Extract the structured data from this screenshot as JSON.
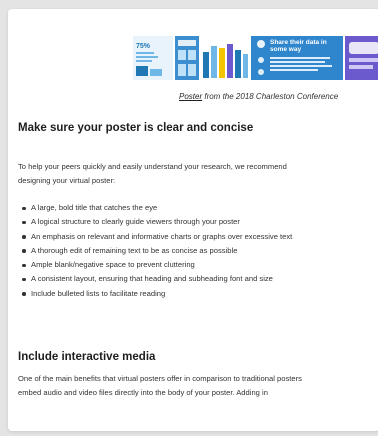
{
  "caption": {
    "link_text": "Poster",
    "rest": " from the 2018 Charleston Conference"
  },
  "poster": {
    "percent": "75%",
    "headline_line1": "Share their data in",
    "headline_line2": "some way"
  },
  "section1": {
    "heading": "Make sure your poster is clear and concise",
    "intro_line1": "To help your peers quickly and easily understand your research, we recommend",
    "intro_line2": "designing your virtual poster:",
    "bullets": [
      "A large, bold title that catches the eye",
      "A logical structure to clearly guide viewers through your poster",
      "An emphasis on relevant and informative charts or graphs over excessive text",
      "A thorough edit of remaining text to be as concise as possible",
      "Ample blank/negative space to prevent cluttering",
      "A consistent layout, ensuring that heading and subheading font and size",
      "Include bulleted lists to facilitate reading"
    ]
  },
  "section2": {
    "heading": "Include interactive media",
    "text_line1": "One of the main benefits that virtual posters offer in comparison to traditional posters",
    "text_line2": "embed audio and video files directly into the body of your poster. Adding in"
  },
  "colors": {
    "page_bg": "#e4e4e4",
    "card_bg": "#ffffff",
    "poster_dark_blue": "#1f78b4",
    "poster_light_blue": "#6fb7e6",
    "poster_purple": "#6a5acd",
    "poster_yellow": "#f2c500"
  }
}
